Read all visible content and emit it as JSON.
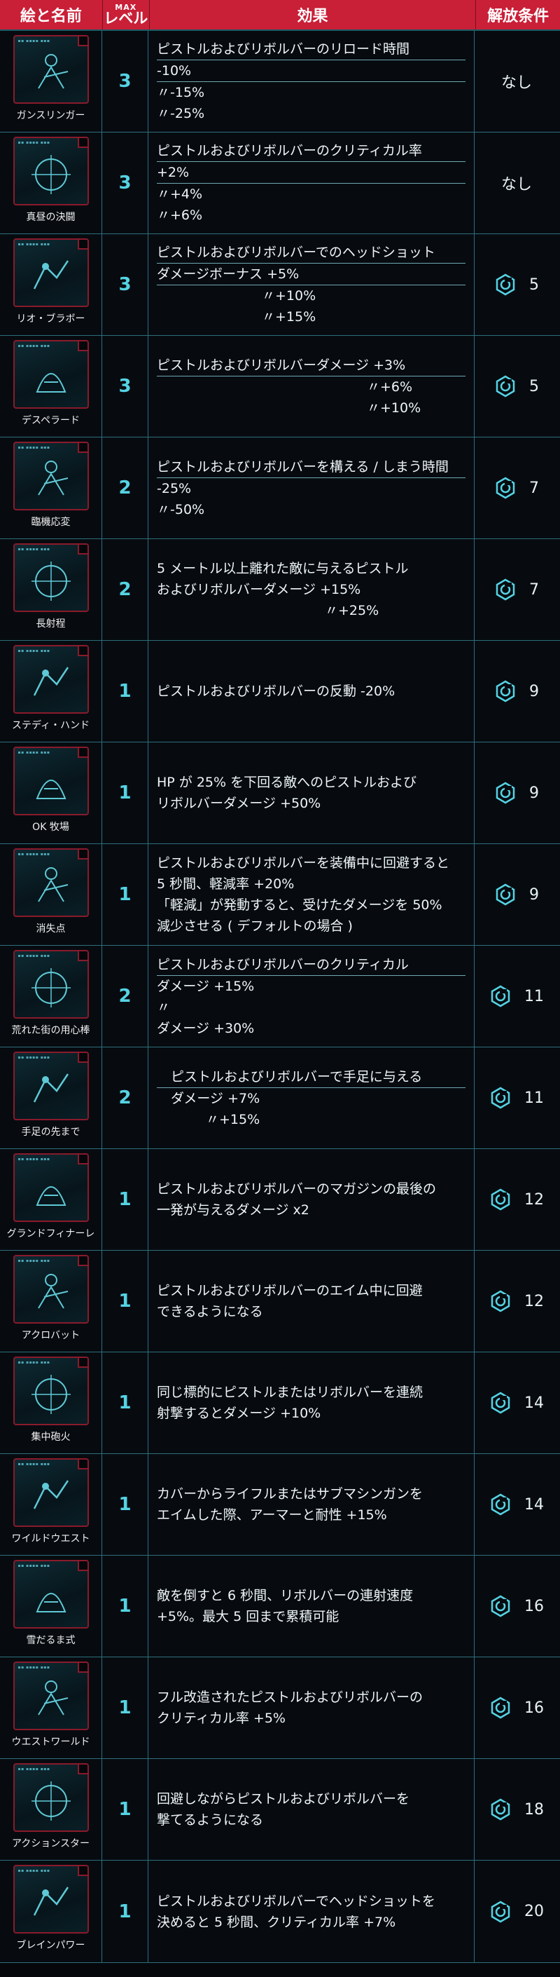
{
  "header": {
    "name": "絵と名前",
    "max": "MAX",
    "level": "レベル",
    "effect": "効果",
    "unlock": "解放条件"
  },
  "colors": {
    "accent_red": "#c91f37",
    "cyan": "#55d3e3",
    "border": "#2d6e7a"
  },
  "rows": [
    {
      "name": "ガンスリンガー",
      "level": "3",
      "unlock": "なし",
      "unlock_icon": false,
      "lines": [
        "ピストルおよびリボルバーのリロード時間",
        "-10%",
        "〃-15%",
        "〃-25%"
      ]
    },
    {
      "name": "真昼の決闘",
      "level": "3",
      "unlock": "なし",
      "unlock_icon": false,
      "lines": [
        "ピストルおよびリボルバーのクリティカル率",
        "+2%",
        "〃+4%",
        "〃+6%"
      ]
    },
    {
      "name": "リオ・ブラボー",
      "level": "3",
      "unlock": "5",
      "unlock_icon": true,
      "lines": [
        "ピストルおよびリボルバーでのヘッドショット",
        "ダメージボーナス +5%",
        "〃+10%",
        "〃+15%"
      ]
    },
    {
      "name": "デスペラード",
      "level": "3",
      "unlock": "5",
      "unlock_icon": true,
      "lines": [
        "ピストルおよびリボルバーダメージ +3%",
        "〃+6%",
        "〃+10%"
      ]
    },
    {
      "name": "臨機応変",
      "level": "2",
      "unlock": "7",
      "unlock_icon": true,
      "lines": [
        "ピストルおよびリボルバーを構える / しまう時間",
        "-25%",
        "〃-50%"
      ]
    },
    {
      "name": "長射程",
      "level": "2",
      "unlock": "7",
      "unlock_icon": true,
      "lines": [
        "5 メートル以上離れた敵に与えるピストル",
        "およびリボルバーダメージ +15%",
        "〃+25%"
      ]
    },
    {
      "name": "ステディ・ハンド",
      "level": "1",
      "unlock": "9",
      "unlock_icon": true,
      "lines": [
        "ピストルおよびリボルバーの反動 -20%"
      ]
    },
    {
      "name": "OK 牧場",
      "level": "1",
      "unlock": "9",
      "unlock_icon": true,
      "lines": [
        "HP が 25% を下回る敵へのピストルおよび",
        "リボルバーダメージ +50%"
      ]
    },
    {
      "name": "消失点",
      "level": "1",
      "unlock": "9",
      "unlock_icon": true,
      "lines": [
        "ピストルおよびリボルバーを装備中に回避すると",
        "5 秒間、軽減率 +20%",
        "「軽減」が発動すると、受けたダメージを 50%",
        "減少させる ( デフォルトの場合 )"
      ]
    },
    {
      "name": "荒れた街の用心棒",
      "level": "2",
      "unlock": "11",
      "unlock_icon": true,
      "lines": [
        "ピストルおよびリボルバーのクリティカル",
        "ダメージ +15%",
        "〃",
        "ダメージ +30%"
      ]
    },
    {
      "name": "手足の先まで",
      "level": "2",
      "unlock": "11",
      "unlock_icon": true,
      "lines": [
        "ピストルおよびリボルバーで手足に与える",
        "ダメージ +7%",
        "〃+15%"
      ]
    },
    {
      "name": "グランドフィナーレ",
      "level": "1",
      "unlock": "12",
      "unlock_icon": true,
      "lines": [
        "ピストルおよびリボルバーのマガジンの最後の",
        "一発が与えるダメージ x2"
      ]
    },
    {
      "name": "アクロバット",
      "level": "1",
      "unlock": "12",
      "unlock_icon": true,
      "lines": [
        "ピストルおよびリボルバーのエイム中に回避",
        "できるようになる"
      ]
    },
    {
      "name": "集中砲火",
      "level": "1",
      "unlock": "14",
      "unlock_icon": true,
      "lines": [
        "同じ標的にピストルまたはリボルバーを連続",
        "射撃するとダメージ +10%"
      ]
    },
    {
      "name": "ワイルドウエスト",
      "level": "1",
      "unlock": "14",
      "unlock_icon": true,
      "lines": [
        "カバーからライフルまたはサブマシンガンを",
        "エイムした際、アーマーと耐性 +15%"
      ]
    },
    {
      "name": "雪だるま式",
      "level": "1",
      "unlock": "16",
      "unlock_icon": true,
      "lines": [
        "敵を倒すと 6 秒間、リボルバーの連射速度",
        "+5%。最大 5 回まで累積可能"
      ]
    },
    {
      "name": "ウエストワールド",
      "level": "1",
      "unlock": "16",
      "unlock_icon": true,
      "lines": [
        "フル改造されたピストルおよびリボルバーの",
        "クリティカル率 +5%"
      ]
    },
    {
      "name": "アクションスター",
      "level": "1",
      "unlock": "18",
      "unlock_icon": true,
      "lines": [
        "回避しながらピストルおよびリボルバーを",
        "撃てるようになる"
      ]
    },
    {
      "name": "ブレインパワー",
      "level": "1",
      "unlock": "20",
      "unlock_icon": true,
      "lines": [
        "ピストルおよびリボルバーでヘッドショットを",
        "決めると 5 秒間、クリティカル率 +7%"
      ]
    }
  ]
}
